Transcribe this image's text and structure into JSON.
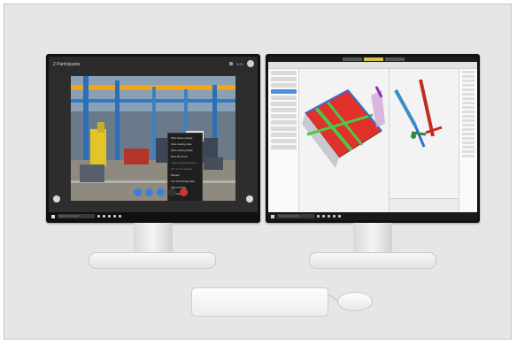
{
  "left_monitor": {
    "call_title": "2 Participants",
    "participant_count": "3:21",
    "context_menu": {
      "items": [
        {
          "label": "Show device settings",
          "dim": false
        },
        {
          "label": "Show meeting notes",
          "dim": false
        },
        {
          "label": "Show meeting details",
          "dim": false
        },
        {
          "label": "Enter full screen",
          "dim": false
        },
        {
          "label": "Apply background effects",
          "dim": true
        },
        {
          "label": "Turn on live captions",
          "dim": true
        },
        {
          "label": "Dial pad",
          "dim": false
        },
        {
          "label": "Turn off incoming video",
          "dim": false
        },
        {
          "label": "Start recording",
          "dim": false
        },
        {
          "label": "End meeting",
          "dim": false
        }
      ]
    },
    "taskbar": {
      "search_placeholder": "Type here to search"
    }
  },
  "right_monitor": {
    "taskbar": {
      "search_placeholder": "Type here to search"
    }
  },
  "colors": {
    "accent_blue": "#3c7fd6",
    "end_call_red": "#d23232",
    "cad_red": "#e0312a",
    "cad_green": "#4cc84a",
    "cad_blue": "#2f6fd8",
    "active_tab": "#cfc24a"
  },
  "icons": {
    "call_controls": [
      "video-camera-icon",
      "microphone-icon",
      "share-icon",
      "more-icon",
      "hang-up-icon"
    ]
  }
}
